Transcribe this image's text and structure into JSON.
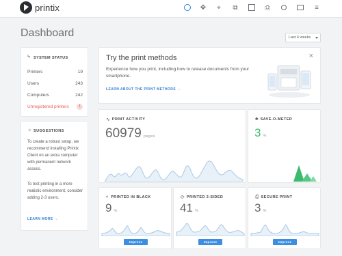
{
  "app": {
    "brand": "printix"
  },
  "nav": {
    "items": [
      {
        "name": "dashboard-icon"
      },
      {
        "name": "network-icon"
      },
      {
        "name": "location-icon"
      },
      {
        "name": "hierarchy-icon"
      },
      {
        "name": "documents-icon"
      },
      {
        "name": "printer-icon"
      },
      {
        "name": "user-icon"
      },
      {
        "name": "computer-icon"
      },
      {
        "name": "menu-icon"
      }
    ]
  },
  "page": {
    "title": "Dashboard",
    "period": "Last 4 weeks"
  },
  "system_status": {
    "heading": "System status",
    "rows": [
      {
        "label": "Printers",
        "value": "19"
      },
      {
        "label": "Users",
        "value": "243"
      },
      {
        "label": "Computers",
        "value": "242"
      },
      {
        "label": "Unregistered printers",
        "value": "1"
      }
    ]
  },
  "suggestions": {
    "heading": "Suggestions",
    "p1": "To create a robust setup, we recommend installing Printix Client on an extra computer with permanent network access.",
    "p2": "To test printing in a more realistic environment, consider adding 2-3 users.",
    "link": "Learn more"
  },
  "try_print": {
    "title": "Try the print methods",
    "text": "Experience how you print, including how to release documents from your smartphone.",
    "link": "Learn about the print methods",
    "close": "×"
  },
  "print_activity": {
    "heading": "Print activity",
    "value": "60979",
    "unit": "pages"
  },
  "save_o_meter": {
    "heading": "Save-o-meter",
    "value": "3",
    "unit": "%"
  },
  "printed_black": {
    "heading": "Printed in black",
    "value": "9",
    "unit": "%",
    "button": "Improve"
  },
  "printed_2sided": {
    "heading": "Printed 2-sided",
    "value": "41",
    "unit": "%",
    "button": "Improve"
  },
  "secure_print": {
    "heading": "Secure print",
    "value": "3",
    "unit": "%",
    "button": "Improve"
  },
  "colors": {
    "accent": "#2e7fd1",
    "button": "#3b8ee0",
    "green": "#3cba6e",
    "warn": "#e0615b",
    "spark": "#a9c8e6"
  }
}
